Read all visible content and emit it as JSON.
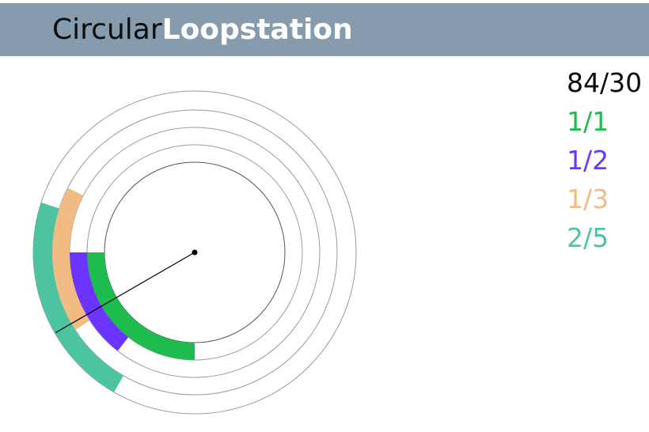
{
  "app": {
    "title_light": "Circular",
    "title_bold": "Loopstation"
  },
  "tempo": "84/30",
  "colors": {
    "header_bg": "#869bad",
    "ring_outline": "#9a9a9a",
    "hand": "#000000"
  },
  "hand": {
    "note": "Playhead angle in degrees, clockwise from 12 o'clock",
    "angle_deg": 240
  },
  "loops": [
    {
      "id": "ring-1",
      "label": "1/1",
      "color": "#1ebc4e",
      "arc_start_deg": 180,
      "arc_end_deg": 270
    },
    {
      "id": "ring-2",
      "label": "1/2",
      "color": "#6b35ff",
      "arc_start_deg": 218,
      "arc_end_deg": 270
    },
    {
      "id": "ring-3",
      "label": "1/3",
      "color": "#f3bb84",
      "arc_start_deg": 237,
      "arc_end_deg": 297
    },
    {
      "id": "ring-4",
      "label": "2/5",
      "color": "#4cc4a2",
      "arc_start_deg": 210,
      "arc_end_deg": 288
    }
  ]
}
